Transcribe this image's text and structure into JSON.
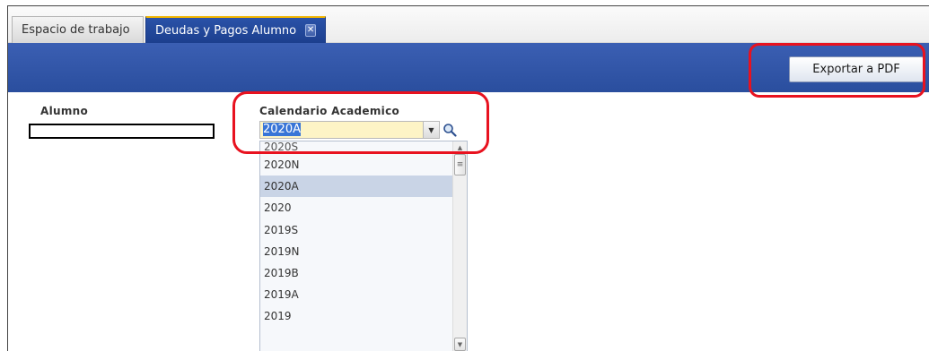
{
  "tabs": [
    {
      "label": "Espacio de trabajo",
      "active": false
    },
    {
      "label": "Deudas y Pagos Alumno",
      "active": true,
      "close_icon": "close-icon"
    }
  ],
  "toolbar": {
    "export_label": "Exportar a PDF"
  },
  "form": {
    "alumno_label": "Alumno",
    "alumno_value": "",
    "calendario_label": "Calendario Academico",
    "calendario_value": "2020A"
  },
  "dropdown": {
    "partial_item": "2020S",
    "items": [
      "2020N",
      "2020A",
      "2020",
      "2019S",
      "2019N",
      "2019B",
      "2019A",
      "2019"
    ],
    "selected": "2020A"
  },
  "colors": {
    "accent_blue": "#2a4e9e",
    "active_tab_border": "#f0b400",
    "highlight_red": "#e8121f",
    "input_bg": "#fdf4c6"
  }
}
